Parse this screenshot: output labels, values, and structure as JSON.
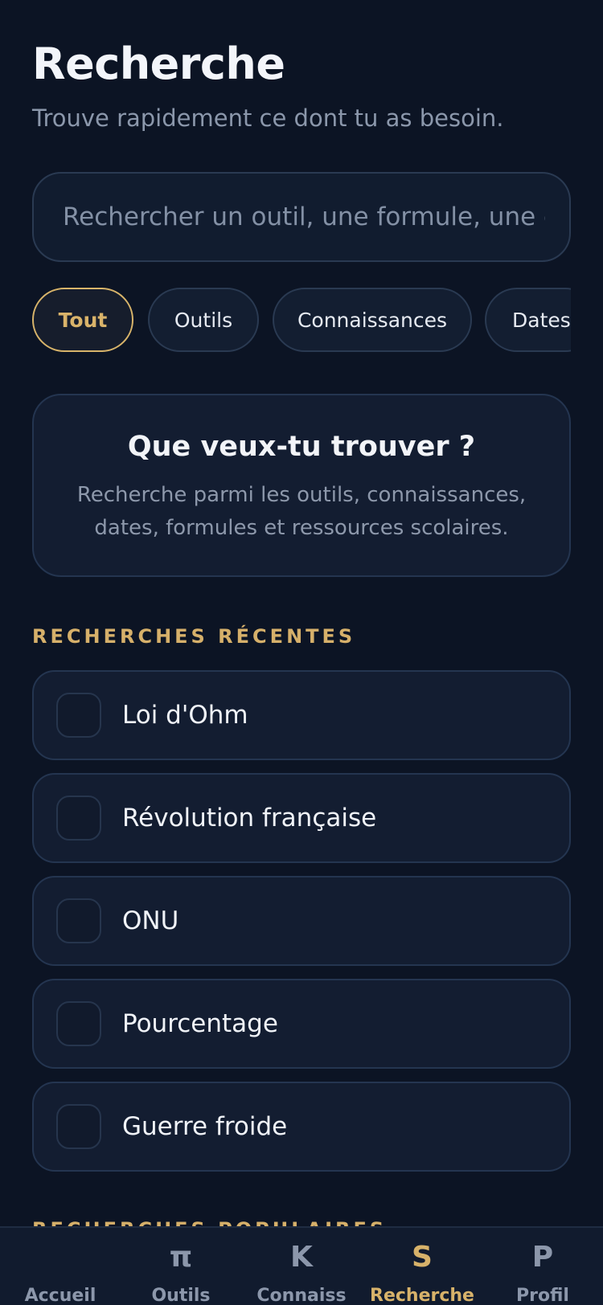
{
  "header": {
    "title": "Recherche",
    "subtitle": "Trouve rapidement ce dont tu as besoin."
  },
  "search": {
    "value": "",
    "placeholder": "Rechercher un outil, une formule, une d"
  },
  "filters": [
    {
      "label": "Tout",
      "active": true
    },
    {
      "label": "Outils",
      "active": false
    },
    {
      "label": "Connaissances",
      "active": false
    },
    {
      "label": "Dates",
      "active": false
    }
  ],
  "empty_state": {
    "title": "Que veux-tu trouver ?",
    "description": "Recherche parmi les outils, connaissances, dates, formules et ressources scolaires."
  },
  "recent": {
    "heading": "RECHERCHES RÉCENTES",
    "items": [
      {
        "label": "Loi d'Ohm"
      },
      {
        "label": "Révolution française"
      },
      {
        "label": "ONU"
      },
      {
        "label": "Pourcentage"
      },
      {
        "label": "Guerre froide"
      }
    ]
  },
  "popular": {
    "heading": "RECHERCHES POPULAIRES"
  },
  "bottom_nav": {
    "items": [
      {
        "glyph": "",
        "label": "Accueil",
        "active": false
      },
      {
        "glyph": "π",
        "label": "Outils",
        "active": false
      },
      {
        "glyph": "K",
        "label": "Connaiss",
        "active": false
      },
      {
        "glyph": "S",
        "label": "Recherche",
        "active": true
      },
      {
        "glyph": "P",
        "label": "Profil",
        "active": false
      }
    ]
  },
  "colors": {
    "background": "#0c1424",
    "card": "#131d31",
    "accent": "#d8b46a",
    "muted_text": "#8b97ab"
  }
}
